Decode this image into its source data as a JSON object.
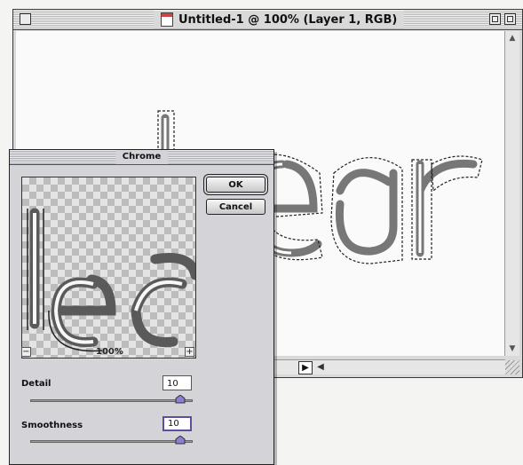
{
  "document_window": {
    "title": "Untitled-1 @ 100% (Layer 1, RGB)"
  },
  "dialog": {
    "title": "Chrome",
    "ok_label": "OK",
    "cancel_label": "Cancel",
    "zoom_level": "100%",
    "detail": {
      "label": "Detail",
      "value": "10"
    },
    "smoothness": {
      "label": "Smoothness",
      "value": "10"
    }
  },
  "colors": {
    "slider_thumb": "#8a7fd0",
    "focus_ring": "#5a4ea8"
  },
  "icons": [
    "close-box-icon",
    "zoom-box-icon",
    "collapse-box-icon",
    "document-icon",
    "scroll-up-arrow-icon",
    "scroll-down-arrow-icon",
    "scroll-left-arrow-icon",
    "scroll-right-arrow-icon",
    "zoom-out-icon",
    "zoom-in-icon",
    "slider-thumb-icon"
  ]
}
